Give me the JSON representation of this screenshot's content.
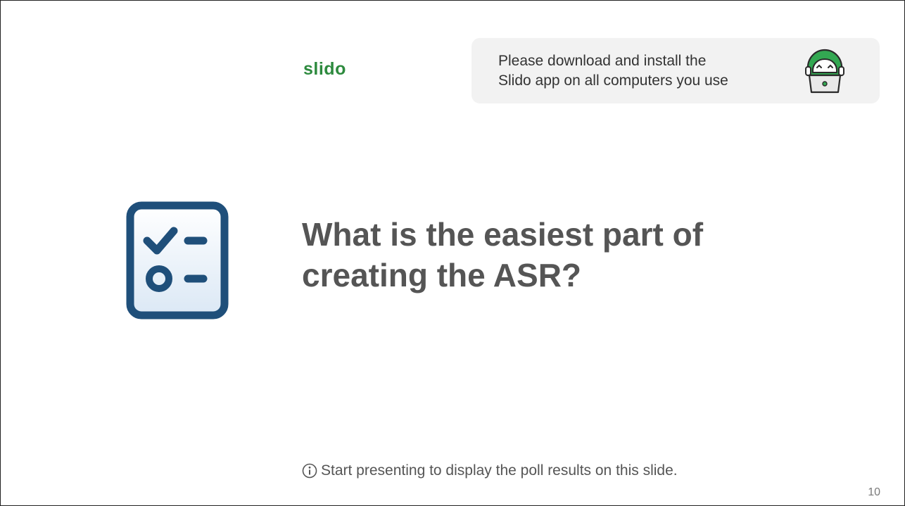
{
  "slide": {
    "logo_text": "slido",
    "banner_line1": "Please download and install the",
    "banner_line2": "Slido app on all computers you use",
    "mascot_icon": "slido-mascot-laptop-icon",
    "poll_icon": "poll-checklist-icon",
    "question_line1": "What is the easiest part of",
    "question_line2": "creating the ASR?",
    "info_icon": "info-icon",
    "hint_text": "Start presenting to display the poll results on this slide.",
    "page_number": "10"
  },
  "colors": {
    "brand_green": "#2d8a3e",
    "icon_blue": "#1f4f7a",
    "icon_fill": "#e4eef8",
    "banner_bg": "#f2f2f2",
    "question_text": "#555555"
  }
}
